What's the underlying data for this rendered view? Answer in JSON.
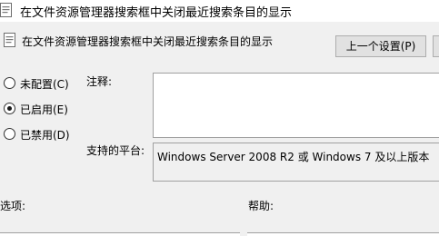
{
  "window": {
    "title": "在文件资源管理器搜索框中关闭最近搜索条目的显示"
  },
  "header": {
    "setting_name": "在文件资源管理器搜索框中关闭最近搜索条目的显示",
    "prev_button": "上一个设置(P)",
    "next_button": ""
  },
  "state": {
    "options": [
      {
        "label": "未配置(C)",
        "selected": false
      },
      {
        "label": "已启用(E)",
        "selected": true
      },
      {
        "label": "已禁用(D)",
        "selected": false
      }
    ]
  },
  "comment": {
    "label": "注释:",
    "value": ""
  },
  "platform": {
    "label": "支持的平台:",
    "value": "Windows Server 2008 R2 或 Windows 7 及以上版本"
  },
  "sections": {
    "options_label": "选项:",
    "help_label": "帮助:"
  },
  "icons": {
    "window_icon": "policy-document-icon",
    "setting_icon": "policy-document-icon"
  }
}
